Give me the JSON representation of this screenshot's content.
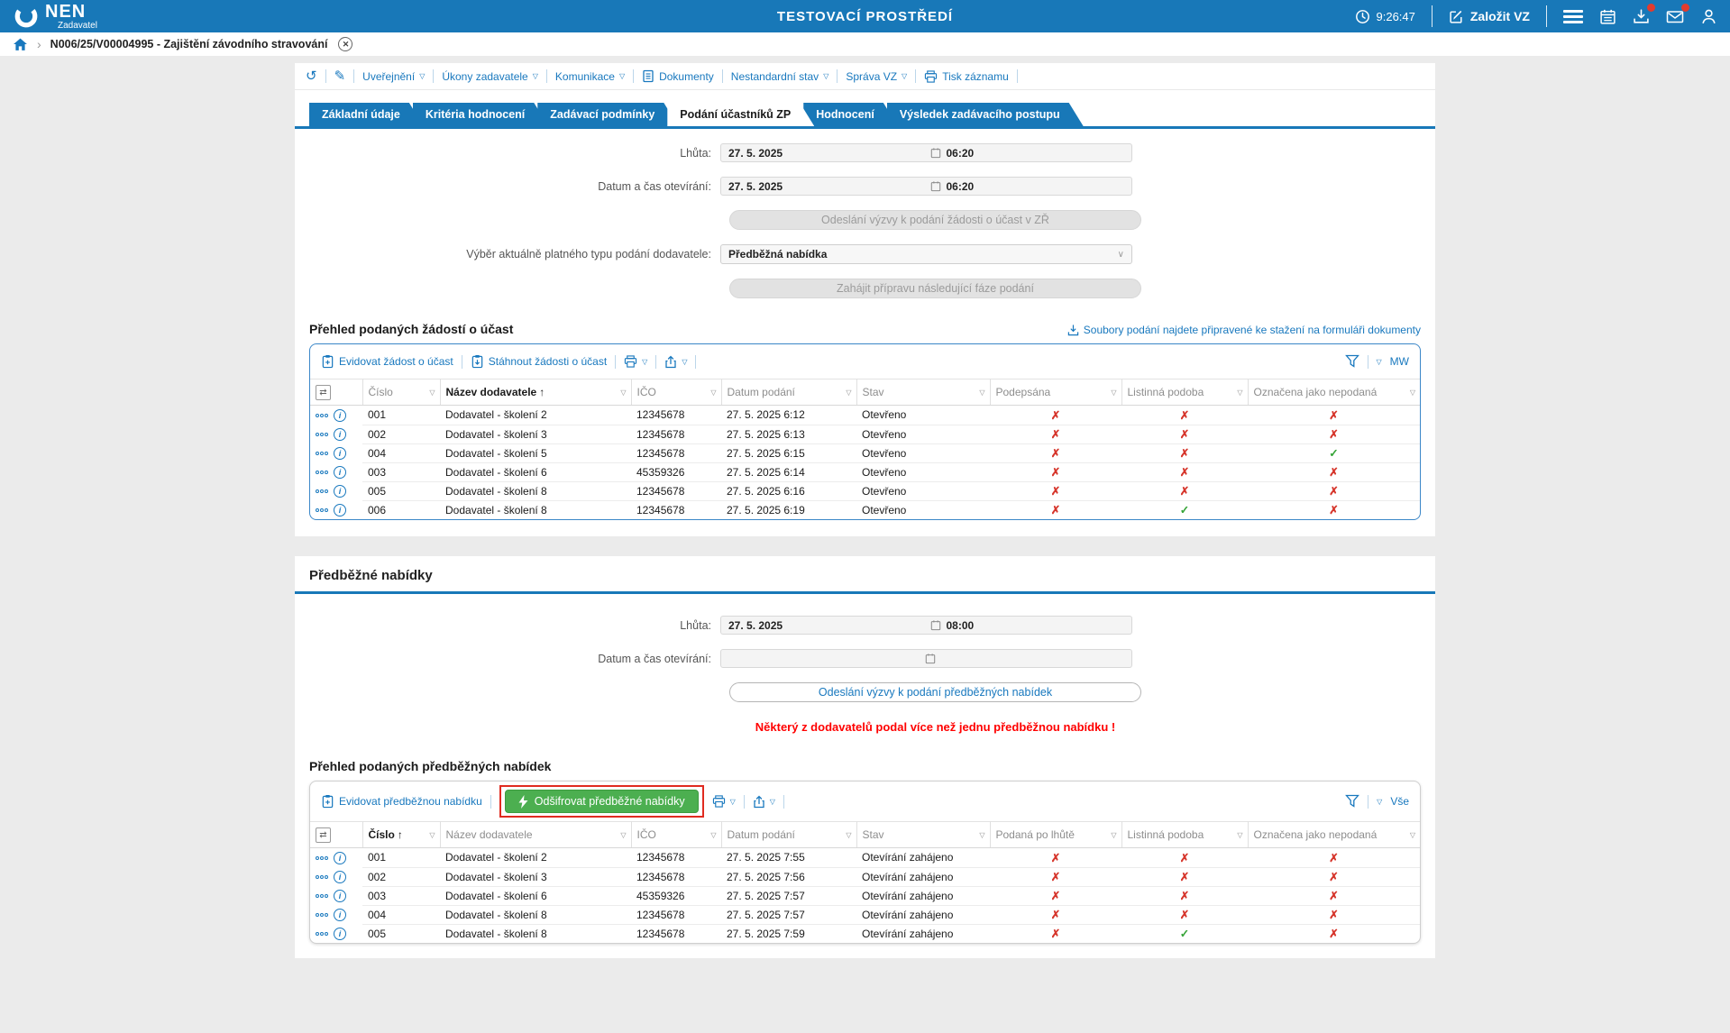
{
  "header": {
    "brand": "NEN",
    "brand_sub": "Zadavatel",
    "env_title": "TESTOVACÍ PROSTŘEDÍ",
    "clock": "9:26:47",
    "create_vz": "Založit VZ"
  },
  "breadcrumb": {
    "record": "N006/25/V00004995 - Zajištění závodního stravování"
  },
  "record_toolbar": {
    "items": [
      {
        "label": "Uveřejnění"
      },
      {
        "label": "Úkony zadavatele"
      },
      {
        "label": "Komunikace"
      },
      {
        "label": "Dokumenty"
      },
      {
        "label": "Nestandardní stav"
      },
      {
        "label": "Správa VZ"
      },
      {
        "label": "Tisk záznamu"
      }
    ]
  },
  "tabs": [
    {
      "label": "Základní údaje",
      "active": false
    },
    {
      "label": "Kritéria hodnocení",
      "active": false
    },
    {
      "label": "Zadávací podmínky",
      "active": false
    },
    {
      "label": "Podání účastníků ZP",
      "active": true
    },
    {
      "label": "Hodnocení",
      "active": false
    },
    {
      "label": "Výsledek zadávacího postupu",
      "active": false
    }
  ],
  "participation": {
    "deadline_label": "Lhůta:",
    "deadline_date": "27. 5. 2025",
    "deadline_time": "06:20",
    "opening_label": "Datum a čas otevírání:",
    "opening_date": "27. 5. 2025",
    "opening_time": "06:20",
    "send_request_btn": "Odeslání výzvy k podání žádosti o účast v ZŘ",
    "submission_type_label": "Výběr aktuálně platného typu podání dodavatele:",
    "submission_type_value": "Předběžná nabídka",
    "next_phase_btn": "Zahájit přípravu následující fáze podání",
    "table_title": "Přehled podaných žádostí o účast",
    "files_link": "Soubory podání najdete připravené ke stažení na formuláři dokumenty",
    "table": {
      "actions": [
        {
          "label": "Evidovat žádost o účast"
        },
        {
          "label": "Stáhnout žádosti o účast"
        }
      ],
      "view_label": "MW",
      "headers": [
        "Číslo",
        "Název dodavatele",
        "IČO",
        "Datum podání",
        "Stav",
        "Podepsána",
        "Listinná podoba",
        "Označena jako nepodaná"
      ],
      "sorted_col": 1,
      "sort_dir": "asc",
      "flag_cols": [
        5,
        6,
        7
      ],
      "rows": [
        [
          "001",
          "Dodavatel - školení 2",
          "12345678",
          "27. 5. 2025 6:12",
          "Otevřeno",
          "no",
          "no",
          "no"
        ],
        [
          "002",
          "Dodavatel - školení 3",
          "12345678",
          "27. 5. 2025 6:13",
          "Otevřeno",
          "no",
          "no",
          "no"
        ],
        [
          "004",
          "Dodavatel - školení 5",
          "12345678",
          "27. 5. 2025 6:15",
          "Otevřeno",
          "no",
          "no",
          "yes"
        ],
        [
          "003",
          "Dodavatel - školení 6",
          "45359326",
          "27. 5. 2025 6:14",
          "Otevřeno",
          "no",
          "no",
          "no"
        ],
        [
          "005",
          "Dodavatel - školení 8",
          "12345678",
          "27. 5. 2025 6:16",
          "Otevřeno",
          "no",
          "no",
          "no"
        ],
        [
          "006",
          "Dodavatel - školení 8",
          "12345678",
          "27. 5. 2025 6:19",
          "Otevřeno",
          "no",
          "yes",
          "no"
        ]
      ]
    }
  },
  "preliminary": {
    "title": "Předběžné nabídky",
    "deadline_label": "Lhůta:",
    "deadline_date": "27. 5. 2025",
    "deadline_time": "08:00",
    "opening_label": "Datum a čas otevírání:",
    "send_btn": "Odeslání výzvy k podání předběžných nabídek",
    "warning": "Některý z dodavatelů podal více než jednu předběžnou nabídku !",
    "table_title": "Přehled podaných předběžných nabídek",
    "table": {
      "actions": [
        {
          "label": "Evidovat předběžnou nabídku"
        }
      ],
      "decrypt_btn": "Odšifrovat předběžné nabídky",
      "view_label": "Vše",
      "headers": [
        "Číslo",
        "Název dodavatele",
        "IČO",
        "Datum podání",
        "Stav",
        "Podaná po lhůtě",
        "Listinná podoba",
        "Označena jako nepodaná"
      ],
      "sorted_col": 0,
      "sort_dir": "asc",
      "flag_cols": [
        5,
        6,
        7
      ],
      "rows": [
        [
          "001",
          "Dodavatel - školení 2",
          "12345678",
          "27. 5. 2025 7:55",
          "Otevírání zahájeno",
          "no",
          "no",
          "no"
        ],
        [
          "002",
          "Dodavatel - školení 3",
          "12345678",
          "27. 5. 2025 7:56",
          "Otevírání zahájeno",
          "no",
          "no",
          "no"
        ],
        [
          "003",
          "Dodavatel - školení 6",
          "45359326",
          "27. 5. 2025 7:57",
          "Otevírání zahájeno",
          "no",
          "no",
          "no"
        ],
        [
          "004",
          "Dodavatel - školení 8",
          "12345678",
          "27. 5. 2025 7:57",
          "Otevírání zahájeno",
          "no",
          "no",
          "no"
        ],
        [
          "005",
          "Dodavatel - školení 8",
          "12345678",
          "27. 5. 2025 7:59",
          "Otevírání zahájeno",
          "no",
          "yes",
          "no"
        ]
      ]
    }
  },
  "colors": {
    "header_bg": "#1878b8",
    "accent_blue": "#1878be",
    "flag_no": "#d6352b",
    "flag_yes": "#36a438",
    "warning_red": "#ff0000",
    "decrypt_green": "#4caf50",
    "annotation_red": "#e02b20"
  }
}
